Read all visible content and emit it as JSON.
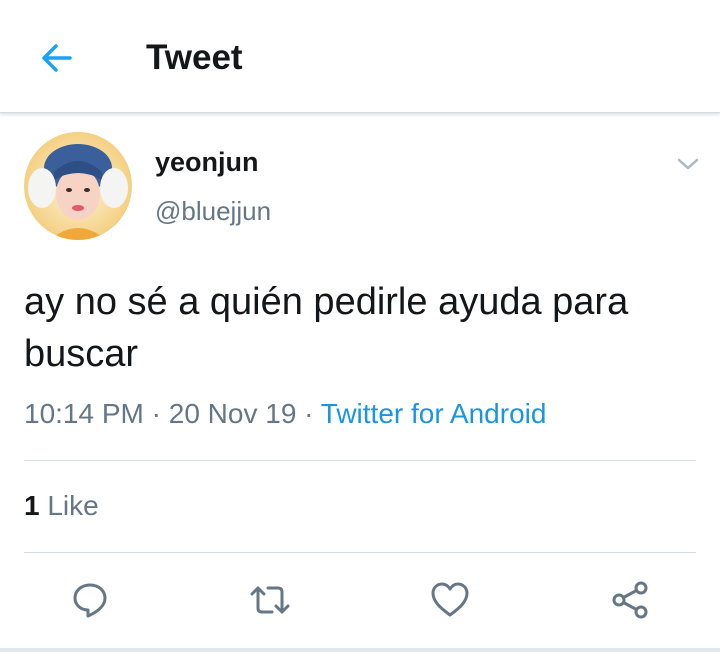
{
  "header": {
    "title": "Tweet",
    "back_icon": "arrow-left-icon",
    "accent": "#1da1f2"
  },
  "tweet": {
    "author": {
      "name": "yeonjun",
      "handle": "@bluejjun"
    },
    "text": "ay no sé a quién pedirle ayuda para buscar",
    "time": "10:14 PM",
    "separator": " · ",
    "date": "20 Nov 19",
    "source": "Twitter for Android",
    "likes": {
      "count": "1",
      "label": "Like"
    }
  },
  "actions": [
    "reply-icon",
    "retweet-icon",
    "like-icon",
    "share-icon"
  ],
  "colors": {
    "link": "#1b95e0",
    "secondary": "#657786",
    "text": "#14171a"
  }
}
